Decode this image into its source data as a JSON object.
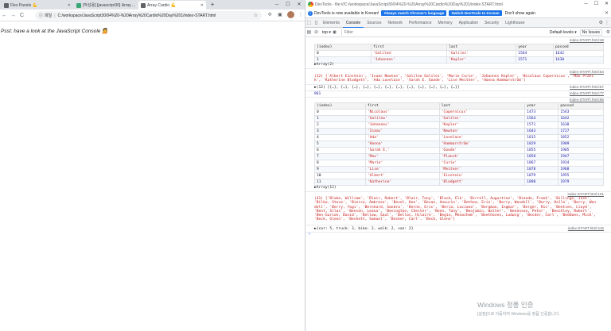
{
  "browser": {
    "tabs": [
      {
        "title": "Flex Panels 💪",
        "color": "#5f6368"
      },
      {
        "title": "[작성용] [javascript30] Array ...",
        "color": "#3ba776"
      },
      {
        "title": "Array Cardio 💪",
        "color": "#5f6368"
      }
    ],
    "nav": {
      "back": "←",
      "forward": "→",
      "reload": "C",
      "new_tab": "+"
    },
    "address": {
      "scheme": "파일",
      "url": "C:/workspace/JavaScript30/04%20-%20Array%20Cardio%20Day%201/index-START.html"
    },
    "page_text": "Psst: have a look at the JavaScript Console 💁"
  },
  "devtools": {
    "title": "DevTools - file:///C:/workspace/JavaScript30/04%20-%20Array%20Cardio%20Day%201/index-START.html",
    "infobar": {
      "message": "DevTools is now available in Korean!",
      "match_button": "Always match Chrome's language",
      "switch_button": "Switch DevTools to Korean",
      "dismiss": "Don't show again"
    },
    "tabs": [
      "Elements",
      "Console",
      "Sources",
      "Network",
      "Performance",
      "Memory",
      "Application",
      "Security",
      "Lighthouse"
    ],
    "active_tab": "Console",
    "console_bar": {
      "context": "top",
      "filter_placeholder": "Filter",
      "levels": "Default levels ▾",
      "issues": "No Issues"
    },
    "console": {
      "table1": {
        "source": "index-START.html:48",
        "headers": [
          "(index)",
          "first",
          "last",
          "year",
          "passed"
        ],
        "rows": [
          [
            "0",
            "'Galileo'",
            "'Galilei'",
            "1564",
            "1642"
          ],
          [
            "1",
            "'Johannes'",
            "'Kepler'",
            "1571",
            "1630"
          ]
        ],
        "footer": "▶Array(2)"
      },
      "log2": {
        "source": "index-START.html:54",
        "text": "(12) ['Albert Einstein', 'Isaac Newton', 'Galileo Galilei', 'Marie Curie', 'Johannes Kepler', 'Nicolaus Copernicus', 'Max Planck', 'Katherine Blodgett', 'Ada Lovelace', 'Sarah E. Goode', 'Lise Meitner', 'Hanna Hammarström']"
      },
      "log3": {
        "source": "index-START.html:67",
        "text": "▶(12) [{…}, {…}, {…}, {…}, {…}, {…}, {…}, {…}, {…}, {…}, {…}, {…}]"
      },
      "log4": {
        "source": "index-START.html:77",
        "text": "861"
      },
      "table2": {
        "source": "index-START.html:85",
        "headers": [
          "(index)",
          "first",
          "last",
          "year",
          "passed"
        ],
        "rows": [
          [
            "0",
            "'Nicolaus'",
            "'Copernicus'",
            "1473",
            "1543"
          ],
          [
            "1",
            "'Galileo'",
            "'Galilei'",
            "1564",
            "1642"
          ],
          [
            "2",
            "'Johannes'",
            "'Kepler'",
            "1571",
            "1630"
          ],
          [
            "3",
            "'Isaac'",
            "'Newton'",
            "1643",
            "1727"
          ],
          [
            "4",
            "'Ada'",
            "'Lovelace'",
            "1815",
            "1852"
          ],
          [
            "5",
            "'Hanna'",
            "'Hammarström'",
            "1829",
            "1909"
          ],
          [
            "6",
            "'Sarah E.'",
            "'Goode'",
            "1855",
            "1905"
          ],
          [
            "7",
            "'Max'",
            "'Planck'",
            "1858",
            "1947"
          ],
          [
            "8",
            "'Marie'",
            "'Curie'",
            "1867",
            "1934"
          ],
          [
            "9",
            "'Lise'",
            "'Meitner'",
            "1878",
            "1968"
          ],
          [
            "10",
            "'Albert'",
            "'Einstein'",
            "1879",
            "1955"
          ],
          [
            "11",
            "'Katherine'",
            "'Blodgett'",
            "1898",
            "1979"
          ]
        ],
        "footer": "▶Array(12)"
      },
      "log5": {
        "source": "index-START.html:101",
        "text": "(41) ['Blake, William', 'Blair, Robert', 'Blair, Tony', 'Black, Elk', 'Birrell, Augustine', 'Biondo, Frank', 'Billings, Josh', 'Bilko, Steve', 'Bierce, Ambrose', 'Bevel, Ken', 'Bevan, Aneurin', 'Bethea, Erin', 'Berry, Wendell', 'Berry, Halle', 'Berry, Wendell', 'Berry, Yogi', 'Bernhard, Sandra', 'Berne, Eric', 'Berio, Luciano', 'Bergman, Ingmar', 'Berger, Ric', 'Bentsen, Lloyd', 'Bent, Silas', 'Benson, Leana', 'Benington, Chester', 'Benn, Tony', 'Benjamin, Walter', 'Benenson, Peter', 'Benchley, Robert', 'Ben-Gurion, David', 'Bellow, Saul', 'Belloc, Hilaire', 'Begin, Menachem', 'Beethoven, Ludwig', 'Becker, Carl', 'Beddoes, Mick', 'Beck, Glenn', 'Beckett, Samuel', 'Becker, Carl', 'Beck, Glenn']"
      },
      "log6": {
        "source": "index-START.html:116",
        "text": "▶{car: 5, truck: 3, bike: 2, walk: 2, van: 2}"
      },
      "prompt": "›"
    }
  },
  "watermark": {
    "title": "Windows 정품 인증",
    "subtitle": "[설정]으로 이동하여 Windows를 정품 인증합니다."
  }
}
